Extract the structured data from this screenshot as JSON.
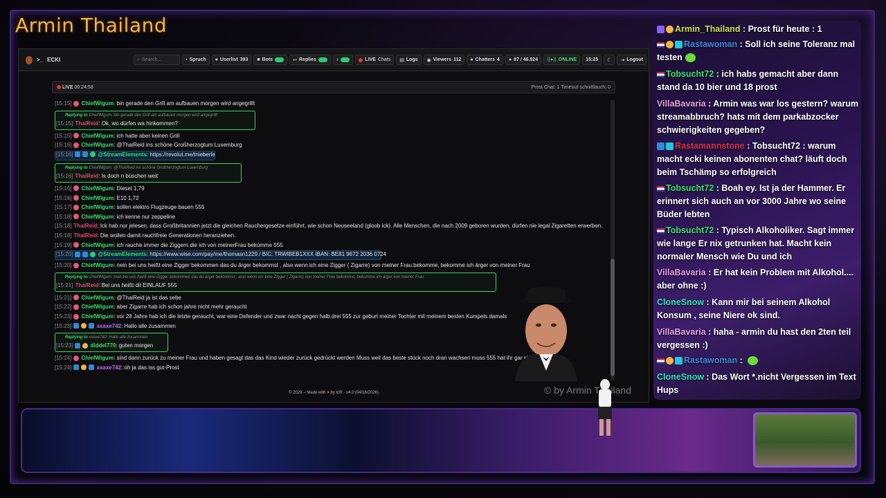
{
  "stream_title": "Armin Thailand",
  "navbar": {
    "brand": "ECKI",
    "search_placeholder": "Search...",
    "spruch": "Spruch",
    "userlist_label": "Userlist",
    "userlist_count": "393",
    "bots": "Bots",
    "replies": "Replies",
    "live": "LIVE",
    "chats": "Chats",
    "logs": "Logs",
    "viewers_label": "Viewers",
    "viewers_count": "112",
    "chatters_label": "Chatters",
    "chatters_count": "4",
    "messages": "87 / 46.924",
    "online": "ONLINE",
    "time": "15:25",
    "logout": "Logout"
  },
  "livebar": {
    "live": "LIVE",
    "uptime": "00:24:58",
    "right": "Prost Chat: 1   Timeout schnittlauch: 0"
  },
  "chatlog": [
    {
      "ts": "[15:15]",
      "user": "ChiefWigum",
      "text": ": bin gerade den Grill am aufbauen morgen wird angegrillt"
    },
    {
      "reply_to": "Replying to",
      "reply_user": "ChiefWigum",
      "reply_text": ": bin gerade den Grill am aufbauen morgen wird angegrillt",
      "ts": "[15:15]",
      "user": "ThaiReid",
      "text": ": Ok, wo dürfen wa hinkommen?"
    },
    {
      "ts": "[15:15]",
      "user": "ChiefWigum",
      "text": ": ich hatte aber keinen Grill"
    },
    {
      "ts": "[15:16]",
      "user": "ChiefWigum",
      "text": ": @ThaiReid ins schöne Großherzogtum Luxemburg"
    },
    {
      "ts": "[15:16]",
      "user": "@StreamElements",
      "text": ": https://revolut.me/tnieberle"
    },
    {
      "reply_to": "Replying to",
      "reply_user": "ChiefWigum",
      "reply_text": ": @ThaiReid ins schöne Großherzogtum Luxemburg",
      "ts": "[15:16]",
      "user": "ThaiReid",
      "text": ": Is doch n büschen weit"
    },
    {
      "ts": "[15:16]",
      "user": "ChiefWigum",
      "text": ": Diesel 1,79"
    },
    {
      "ts": "[15:16]",
      "user": "ChiefWigum",
      "text": ": E10 1,72"
    },
    {
      "ts": "[15:17]",
      "user": "ChiefWigum",
      "text": ": sollen elektro Flugzeuge bauen 555"
    },
    {
      "ts": "[15:18]",
      "user": "ChiefWigum",
      "text": ": ich kenne nur zeppeline"
    },
    {
      "ts": "[15:18]",
      "user": "ThaiReid",
      "text": ": Ick hab nur jelesen, dass Großbritannien jetzt die gleichen Rauchergesetze einführt, wie schon Neuseeland (gloob ick). Alle Menschen, die nach 2009 geboren wurden, dürfen nie legal Zigaretten erwerben."
    },
    {
      "ts": "[15:18]",
      "user": "ThaiReid",
      "text": ": Die wollen damit rauchfreie Generationen heranziehen."
    },
    {
      "ts": "[15:19]",
      "user": "ChiefWigum",
      "text": ": ich rauche immer die Ziggern die ich von meinerFrau bekomme 555"
    },
    {
      "ts": "[15:20]",
      "user": "@StreamElements",
      "text": ": https://www.wise.com/pay/me/thomasn1229 / BIC: TRWIBEB1XXX IBAN: BE81 9672 2036 0724"
    },
    {
      "ts": "[15:20]",
      "user": "ChiefWigum",
      "text": ": nein bei uns heißt eine Zigger bekommen das du ärger bekommst , also wenn ich eine Zigger ( Zigarre) von meiner Frau bekomme, bekomme ich ärger von meiner Frau"
    },
    {
      "reply_to": "Replying to",
      "reply_user": "ChiefWigum",
      "reply_text": ": nein bei uns heißt eine Zigger bekommen das du ärger bekommst , also wenn ich eine Zigger ( Zigarre) von meiner Frau bekomme, bekomme ich ärger von meiner Frau",
      "ts": "[15:21]",
      "user": "ThaiReid",
      "text": ": Bei uns heißt dit EINLAUF 555"
    },
    {
      "ts": "[15:21]",
      "user": "ChiefWigum",
      "text": ": @ThaiReid ja ist das sebe"
    },
    {
      "ts": "[15:22]",
      "user": "ChiefWigum",
      "text": ": aber Zigarre hab ich schon jahre nicht mehr geraucht"
    },
    {
      "ts": "[15:23]",
      "user": "ChiefWigum",
      "text": ": vor 28 Jahre hab ich die letzte geraucht, war eine Defender und zwar nacht gegen halb drei 555 zur geburt meiner Tochter mit meinem besten Kumpels damals"
    },
    {
      "ts": "[15:23]",
      "user": "xxaxe742",
      "text": ": Hallo alle zusammen"
    },
    {
      "reply_to": "Replying to",
      "reply_user": "xxaxe742",
      "reply_text": ": Hallo alle zusammen",
      "ts": "[15:23]",
      "user": "diddel770",
      "text": ": guten morgen"
    },
    {
      "ts": "[15:24]",
      "user": "ChiefWigum",
      "text": ": sind dann zurück zu meiner Frau und haben gesagt das das Kind wieder zurück gedrückt werden Muss weil das beste stück noch dran wachsen muss 555 hat ihr gar nicht gefallen"
    },
    {
      "ts": "[15:24]",
      "user": "xxaxe742",
      "text": ": oh ja das iss gut-Prost"
    }
  ],
  "footer": {
    "left": "© 2026 – Made with",
    "right": "by tcR · v4.0 (04/16/2026)"
  },
  "watermark": "© by Armin Thailand",
  "right_chat": [
    {
      "user": "Armin_Thailand",
      "text": " : Prost für heute : 1"
    },
    {
      "user": "Rastawoman",
      "text": " : Soll ich seine Toleranz mal testen"
    },
    {
      "user": "Tobsucht72",
      "text": " : ich habs gemacht aber dann stand da 10 bier und 18 prost"
    },
    {
      "user": "VillaBavaria",
      "text": " : Armin was war los gestern? warum streamabbruch? hats mit dem parkabzocker schwierigkeiten gegeben?"
    },
    {
      "user": "Rastamannstone",
      "text": " : Tobsucht72 : warum macht ecki keinen abonenten chat? läuft doch beim Tschämp so erfolgreich"
    },
    {
      "user": "Tobsucht72",
      "text": " : Boah ey. Ist ja der Hammer. Er erinnert sich auch an vor 3000 Jahre wo seine Büder lebten"
    },
    {
      "user": "Tobsucht72",
      "text": " : Typisch Alkoholiker. Sagt immer wie lange Er nix getrunken hat. Macht kein normaler Mensch wie Du und ich"
    },
    {
      "user": "VillaBavaria",
      "text": " : Er hat kein Problem mit Alkohol.... aber ohne :)"
    },
    {
      "user": "CloneSnow",
      "text": " : Kann mir bei seinem Alkohol Konsum , seine Niere ok sind."
    },
    {
      "user": "VillaBavaria",
      "text": " : haha - armin du hast den 2ten teil vergessen :)"
    },
    {
      "user": "Rastawoman",
      "text": " : "
    },
    {
      "user": "CloneSnow",
      "text": " : Das Wort *.nicht Vergessen im Text Hups"
    }
  ],
  "colors": {
    "accent": "#f2b544",
    "chat_bg": "#2a1450",
    "green_user": "#39e06a",
    "red_user": "#e0486a"
  }
}
